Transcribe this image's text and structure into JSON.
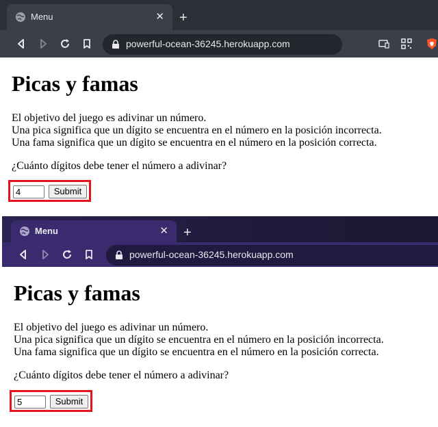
{
  "screenshots": [
    {
      "tab": {
        "title": "Menu",
        "close": "✕",
        "new_tab": "+"
      },
      "address": {
        "url": "powerful-ocean-36245.herokuapp.com"
      },
      "page": {
        "heading": "Picas y famas",
        "description": [
          "El objetivo del juego es adivinar un número.",
          "Una pica significa que un dígito se encuentra en el número en la posición incorrecta.",
          "Una fama significa que un dígito se encuentra en el número en la posición correcta."
        ],
        "question": "¿Cuánto dígitos debe tener el número a adivinar?",
        "input_value": "4",
        "submit_label": "Submit"
      }
    },
    {
      "tab": {
        "title": "Menu",
        "close": "✕",
        "new_tab": "+"
      },
      "address": {
        "url": "powerful-ocean-36245.herokuapp.com"
      },
      "page": {
        "heading": "Picas y famas",
        "description": [
          "El objetivo del juego es adivinar un número.",
          "Una pica significa que un dígito se encuentra en el número en la posición incorrecta.",
          "Una fama significa que un dígito se encuentra en el número en la posición correcta."
        ],
        "question": "¿Cuánto dígitos debe tener el número a adivinar?",
        "input_value": "5",
        "submit_label": "Submit"
      }
    }
  ],
  "colors": {
    "highlight_border": "#e3141b",
    "chrome_dark": "#2b2f36",
    "chrome_purple": "#3a2b6e"
  }
}
